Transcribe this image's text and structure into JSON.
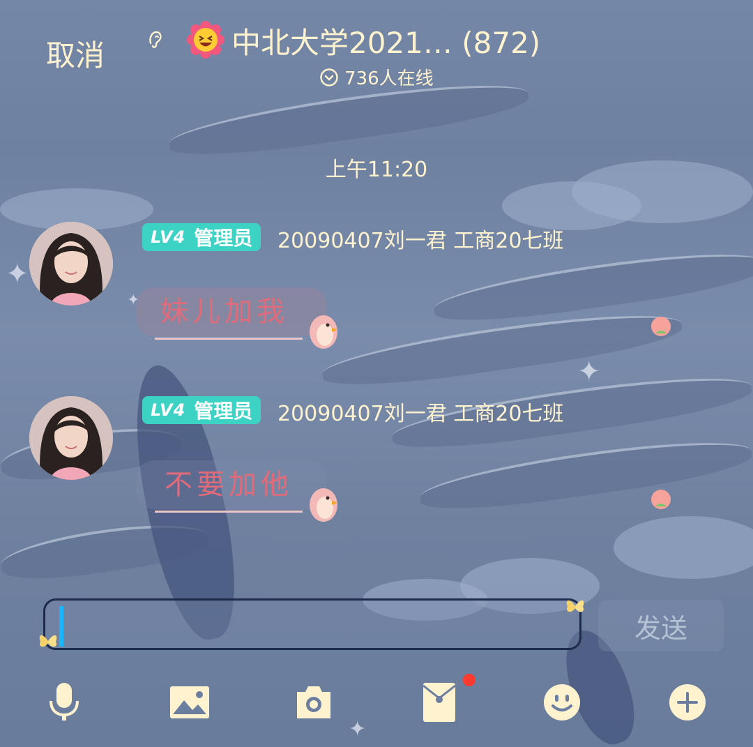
{
  "header": {
    "cancel_label": "取消",
    "group_title": "中北大学2021… (872)",
    "online_text": "736人在线",
    "icons": [
      "ear-icon",
      "laughing-emoji-icon",
      "chevron-down-circle-icon"
    ]
  },
  "chat": {
    "timestamp": "上午11:20",
    "messages": [
      {
        "badge_level": "LV4",
        "badge_role": "管理员",
        "sender": "20090407刘一君 工商20七班",
        "text": "妹儿加我"
      },
      {
        "badge_level": "LV4",
        "badge_role": "管理员",
        "sender": "20090407刘一君 工商20七班",
        "text": "不要加他"
      }
    ]
  },
  "composer": {
    "input_value": "",
    "send_label": "发送"
  },
  "toolbar": {
    "items": [
      "microphone-icon",
      "image-icon",
      "camera-icon",
      "red-packet-icon",
      "emoji-icon",
      "plus-icon"
    ],
    "red_packet_has_notification": true
  },
  "colors": {
    "accent_text": "#fff3cf",
    "badge": "#3dd3c4",
    "bubble_text": "#e06b7a",
    "caret": "#19b6ff",
    "notification": "#ff3b30"
  }
}
